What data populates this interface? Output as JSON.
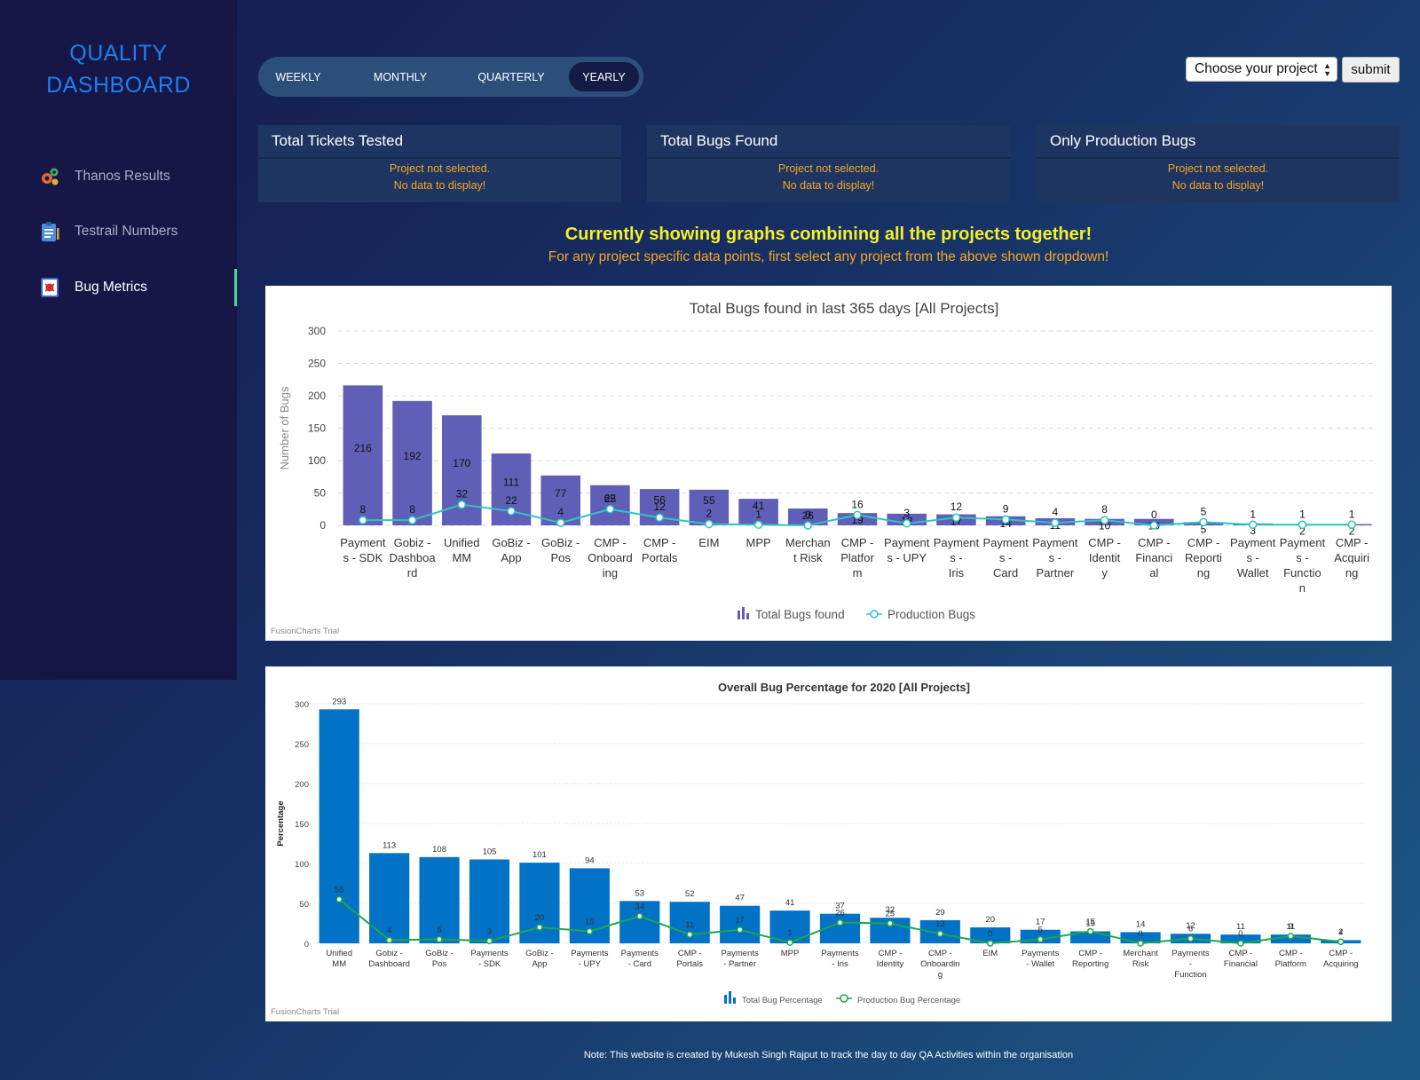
{
  "sidebar": {
    "brand_line1": "QUALITY",
    "brand_line2": "DASHBOARD",
    "items": [
      {
        "label": "Thanos Results",
        "icon": "gears-icon"
      },
      {
        "label": "Testrail Numbers",
        "icon": "clipboard-icon"
      },
      {
        "label": "Bug Metrics",
        "icon": "bug-icon",
        "active": true
      }
    ]
  },
  "periods": {
    "weekly": "WEEKLY",
    "monthly": "MONTHLY",
    "quarterly": "QUARTERLY",
    "yearly": "YEARLY",
    "selected": "YEARLY"
  },
  "project_select": {
    "value": "Choose your project"
  },
  "submit_label": "submit",
  "cards": [
    {
      "title": "Total Tickets Tested",
      "line1": "Project not selected.",
      "line2": "No data to display!"
    },
    {
      "title": "Total Bugs Found",
      "line1": "Project not selected.",
      "line2": "No data to display!"
    },
    {
      "title": "Only Production Bugs",
      "line1": "Project not selected.",
      "line2": "No data to display!"
    }
  ],
  "headline": "Currently showing graphs combining all the projects together!",
  "subline": "For any project specific data points, first select any project from the above shown dropdown!",
  "watermark": "FusionCharts Trial",
  "footer": "Note: This website is created by Mukesh Singh Rajput to track the day to day QA Activities within the organisation",
  "colors": {
    "bar1": "#5f5fb8",
    "line1": "#2ec4c4",
    "bar2": "#0272c6",
    "line2": "#1ea64a",
    "headline": "#f5ef2b",
    "warning": "#f5a623",
    "brand": "#1e7ff0"
  },
  "chart_data": [
    {
      "type": "bar",
      "title": "Total Bugs found in last 365 days [All Projects]",
      "ylabel": "Number of Bugs",
      "xlabel": "",
      "ylim": [
        0,
        300
      ],
      "yticks": [
        0,
        50,
        100,
        150,
        200,
        250,
        300
      ],
      "grid": true,
      "legend": "bottom-center",
      "categories": [
        "Payments - SDK",
        "Gobiz - Dashboard",
        "Unified MM",
        "GoBiz - App",
        "GoBiz - Pos",
        "CMP - Onboarding",
        "CMP - Portals",
        "EIM",
        "MPP",
        "Merchant Risk",
        "CMP - Platform",
        "Payments - UPY",
        "Payments - Iris",
        "Payments - Card",
        "Payments - Partner",
        "CMP - Identity",
        "CMP - Financial",
        "CMP - Reporting",
        "Payments - Wallet",
        "Payments - Function",
        "CMP - Acquiring"
      ],
      "series": [
        {
          "name": "Total Bugs found",
          "kind": "bar",
          "values": [
            216,
            192,
            170,
            111,
            77,
            62,
            56,
            55,
            41,
            26,
            19,
            18,
            17,
            14,
            11,
            10,
            10,
            5,
            3,
            2,
            2
          ]
        },
        {
          "name": "Production Bugs",
          "kind": "line",
          "values": [
            8,
            8,
            32,
            22,
            4,
            25,
            12,
            2,
            1,
            0,
            16,
            3,
            12,
            9,
            4,
            8,
            0,
            5,
            1,
            1,
            1
          ]
        }
      ]
    },
    {
      "type": "bar",
      "title": "Overall Bug Percentage for 2020 [All Projects]",
      "ylabel": "Percentage",
      "xlabel": "",
      "ylim": [
        0,
        300
      ],
      "yticks": [
        0,
        50,
        100,
        150,
        200,
        250,
        300
      ],
      "grid": true,
      "legend": "bottom-center",
      "categories": [
        "Unified MM",
        "Gobiz - Dashboard",
        "GoBiz - Pos",
        "Payments - SDK",
        "GoBiz - App",
        "Payments - UPY",
        "Payments - Card",
        "CMP - Portals",
        "Payments - Partner",
        "MPP",
        "Payments - Iris",
        "CMP - Identity",
        "CMP - Onboarding",
        "EIM",
        "Payments - Wallet",
        "CMP - Reporting",
        "Merchant Risk",
        "Payments - Function",
        "CMP - Financial",
        "CMP - Platform",
        "CMP - Acquiring"
      ],
      "series": [
        {
          "name": "Total Bug Percentage",
          "kind": "bar",
          "values": [
            293,
            113,
            108,
            105,
            101,
            94,
            53,
            52,
            47,
            41,
            37,
            32,
            29,
            20,
            17,
            15,
            14,
            12,
            11,
            11,
            4
          ]
        },
        {
          "name": "Production Bug Percentage",
          "kind": "line",
          "values": [
            55,
            4,
            5,
            3,
            20,
            15,
            34,
            11,
            17,
            1,
            26,
            25,
            12,
            0,
            5,
            15,
            0,
            6,
            0,
            9,
            2
          ]
        }
      ]
    }
  ]
}
